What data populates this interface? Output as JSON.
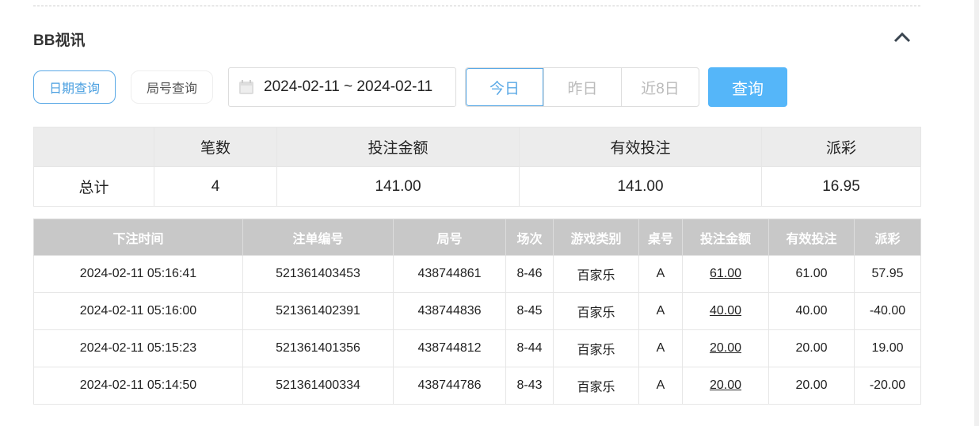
{
  "section_title": "BB视讯",
  "buttons": {
    "date_query": "日期查询",
    "round_query": "局号查询",
    "search": "查询"
  },
  "date_range": "2024-02-11 ~ 2024-02-11",
  "quick_ranges": [
    "今日",
    "昨日",
    "近8日"
  ],
  "summary": {
    "headers": [
      "",
      "笔数",
      "投注金额",
      "有效投注",
      "派彩"
    ],
    "row": [
      "总计",
      "4",
      "141.00",
      "141.00",
      "16.95"
    ]
  },
  "details": {
    "headers": [
      "下注时间",
      "注单编号",
      "局号",
      "场次",
      "游戏类别",
      "桌号",
      "投注金额",
      "有效投注",
      "派彩"
    ],
    "rows": [
      [
        "2024-02-11 05:16:41",
        "521361403453",
        "438744861",
        "8-46",
        "百家乐",
        "A",
        "61.00",
        "61.00",
        "57.95"
      ],
      [
        "2024-02-11 05:16:00",
        "521361402391",
        "438744836",
        "8-45",
        "百家乐",
        "A",
        "40.00",
        "40.00",
        "-40.00"
      ],
      [
        "2024-02-11 05:15:23",
        "521361401356",
        "438744812",
        "8-44",
        "百家乐",
        "A",
        "20.00",
        "20.00",
        "19.00"
      ],
      [
        "2024-02-11 05:14:50",
        "521361400334",
        "438744786",
        "8-43",
        "百家乐",
        "A",
        "20.00",
        "20.00",
        "-20.00"
      ]
    ]
  },
  "colors": {
    "accent": "#55b6f9",
    "negative": "#e8475a"
  }
}
